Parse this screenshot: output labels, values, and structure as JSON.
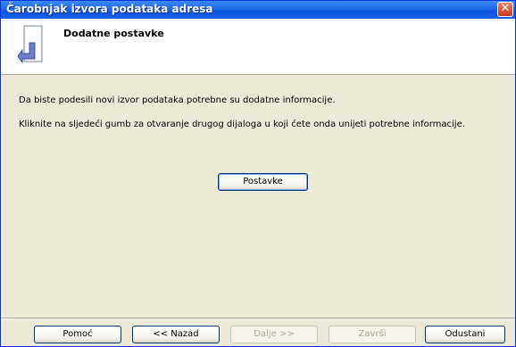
{
  "window": {
    "title": "Čarobnjak izvora podataka adresa",
    "close_glyph": "✕"
  },
  "header": {
    "title": "Dodatne postavke",
    "icon": "document-arrow-icon"
  },
  "content": {
    "line1": "Da biste podesili novi izvor podataka potrebne su dodatne informacije.",
    "line2": "Kliknite na sljedeći gumb za otvaranje drugog dijaloga u koji ćete onda unijeti potrebne informacije.",
    "settings_button": "Postavke"
  },
  "footer": {
    "help": "Pomoć",
    "back": "<< Nazad",
    "next": "Dalje >>",
    "finish": "Završi",
    "cancel": "Odustani"
  },
  "colors": {
    "titlebar": "#0a57e0",
    "dialog_bg": "#ece9d8",
    "button_border": "#003c74"
  }
}
